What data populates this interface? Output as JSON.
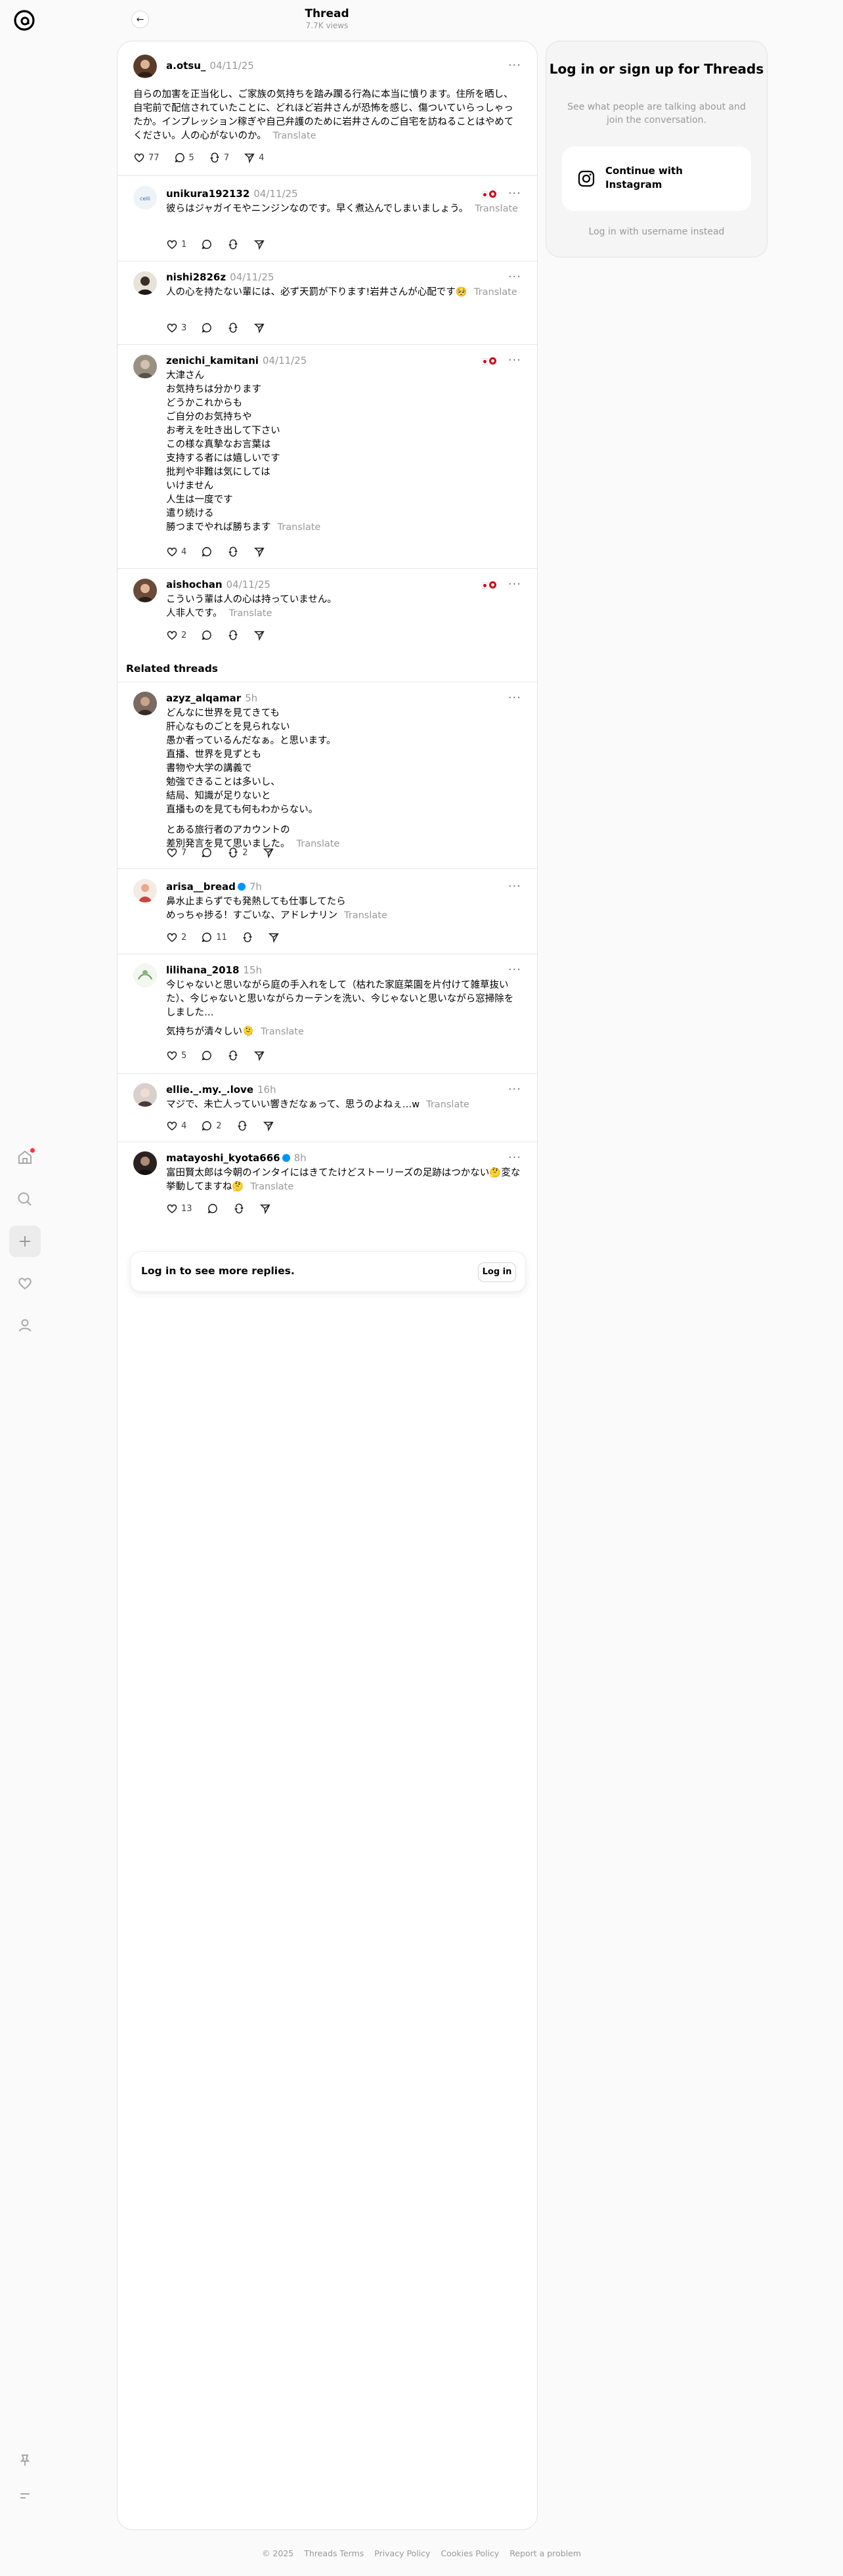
{
  "header": {
    "title": "Thread",
    "views": "7.7K views"
  },
  "nav": {
    "items": [
      "home-icon",
      "search-icon",
      "create-icon",
      "activity-icon",
      "profile-icon",
      "pin-icon",
      "menu-icon"
    ]
  },
  "translate_label": "Translate",
  "main_post": {
    "username": "a.otsu_",
    "time": "04/11/25",
    "text": "自らの加害を正当化し、ご家族の気持ちを踏み躙る行為に本当に憤ります。住所を晒し、自宅前で配信されていたことに、どれほど岩井さんが恐怖を感じ、傷ついていらっしゃったか。インプレッション稼ぎや自己弁護のために岩井さんのご自宅を訪ねることはやめてください。人の心がないのか。",
    "likes": "77",
    "replies": "5",
    "reposts": "7",
    "shares": "4"
  },
  "replies": [
    {
      "username": "unikura192132",
      "time": "04/11/25",
      "text": "彼らはジャガイモやニンジンなのです。早く煮込んでしまいましょう。",
      "likes": "1"
    },
    {
      "username": "nishi2826z",
      "time": "04/11/25",
      "text": "人の心を持たない輩には、必ず天罰が下ります!岩井さんが心配です🥺",
      "likes": "3"
    },
    {
      "username": "zenichi_kamitani",
      "time": "04/11/25",
      "lines": [
        "大津さん",
        "お気持ちは分かります",
        "どうかこれからも",
        "ご自分のお気持ちや",
        "お考えを吐き出して下さい",
        "この様な真摯なお言葉は",
        "支持する者には嬉しいです",
        "批判や非難は気にしては",
        "いけません",
        "人生は一度です",
        "遣り続ける",
        "勝つまでやれば勝ちます"
      ],
      "likes": "4"
    },
    {
      "username": "aishochan",
      "time": "04/11/25",
      "lines": [
        "こういう輩は人の心は持っていません。",
        "人非人です。"
      ],
      "likes": "2"
    }
  ],
  "related": {
    "title": "Related threads",
    "posts": [
      {
        "username": "azyz_alqamar",
        "time": "5h",
        "lines": [
          "どんなに世界を見てきても",
          "肝心なものごとを見られない",
          "愚か者っているんだなぁ。と思います。",
          "直播、世界を見ずとも",
          "書物や大学の講義で",
          "勉強できることは多いし、",
          "結局、知識が足りないと",
          "直播ものを見ても何もわからない。"
        ],
        "lines2": [
          "とある旅行者のアカウントの",
          "差別発言を見て思いました。"
        ],
        "likes": "7",
        "reposts": "2"
      },
      {
        "username": "arisa__bread",
        "time": "7h",
        "lines": [
          "鼻水止まらずでも発熱しても仕事してたら",
          "めっちゃ捗る！すごいな、アドレナリン"
        ],
        "likes": "2",
        "replies": "11"
      },
      {
        "username": "lilihana_2018",
        "time": "15h",
        "text": "今じゃないと思いながら庭の手入れをして（枯れた家庭菜園を片付けて雑草抜いた）、今じゃないと思いながらカーテンを洗い、今じゃないと思いながら窓掃除をしました…",
        "text2": "気持ちが清々しい🫠",
        "likes": "5"
      },
      {
        "username": "ellie._.my._.love",
        "time": "16h",
        "text": "マジで、未亡人っていい響きだなぁって、思うのよねぇ…w",
        "likes": "4",
        "replies": "2"
      },
      {
        "username": "matayoshi_kyota666",
        "time": "8h",
        "text": "富田賢太郎は今朝のインタイにはきてたけどストーリーズの足跡はつかない🤔変な挙動してますね🤔",
        "likes": "13"
      }
    ]
  },
  "login_bar": {
    "text": "Log in to see more replies.",
    "button": "Log in"
  },
  "sidebar": {
    "title": "Log in or sign up for Threads",
    "subtitle": "See what people are talking about and join the conversation.",
    "continue_button": "Continue with Instagram",
    "alt_login": "Log in with username instead"
  },
  "footer": {
    "links": [
      "© 2025",
      "Threads Terms",
      "Privacy Policy",
      "Cookies Policy",
      "Report a problem"
    ]
  },
  "colors": {
    "accent": "#0095f6",
    "notification": "#ff3040"
  }
}
